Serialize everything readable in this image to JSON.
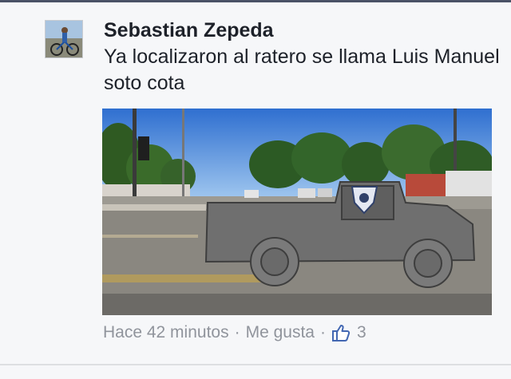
{
  "comment": {
    "author": "Sebastian Zepeda",
    "text": "Ya localizaron al ratero se llama Luis Manuel soto cota",
    "timestamp": "Hace 42 minutos",
    "separator": "·",
    "like_label": "Me gusta",
    "like_count": "3",
    "like_icon": "thumbs-up-icon"
  },
  "colors": {
    "author_text": "#1d2129",
    "meta_text": "#90949c",
    "like_icon": "#4267b2",
    "background": "#f6f7f9"
  }
}
